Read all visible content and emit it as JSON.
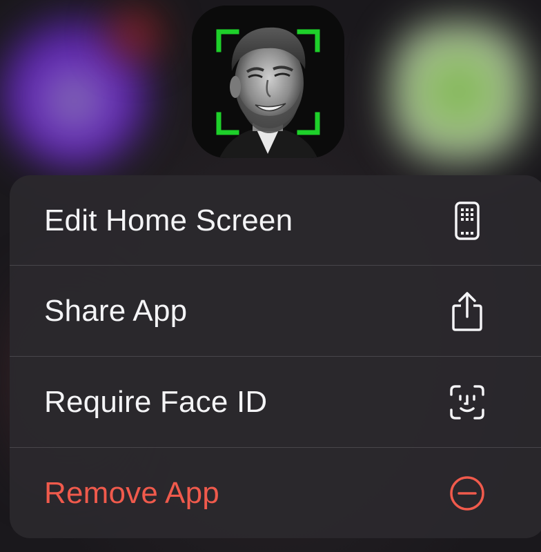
{
  "app": {
    "icon_name": "face-scan-app-icon",
    "accent_color": "#1ed02a"
  },
  "context_menu": {
    "items": [
      {
        "label": "Edit Home Screen",
        "icon": "home-screen-edit-icon",
        "color": "#f4f4f6"
      },
      {
        "label": "Share App",
        "icon": "share-icon",
        "color": "#f4f4f6"
      },
      {
        "label": "Require Face ID",
        "icon": "face-id-icon",
        "color": "#f4f4f6"
      },
      {
        "label": "Remove App",
        "icon": "minus-circle-icon",
        "color": "#f05a4c"
      }
    ]
  }
}
